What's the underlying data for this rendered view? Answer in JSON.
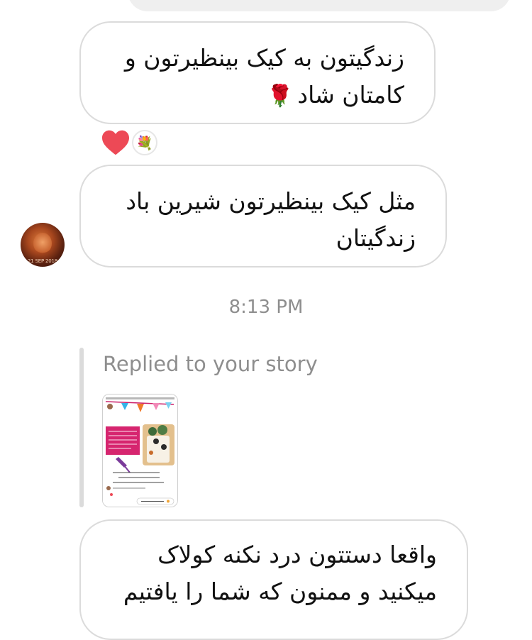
{
  "conversation": {
    "messages": [
      {
        "lines": [
          "زندگیتون به کیک بینظیرتون و",
          "کامتان شاد"
        ],
        "trailing_emoji": "rose-emoji",
        "reactions": [
          "heart-reaction",
          "bouquet-reaction"
        ]
      },
      {
        "lines": [
          "مثل کیک بینظیرتون شیرین باد",
          "زندگیتان"
        ]
      },
      {
        "lines": [
          "واقعا دستتون درد نکنه کولاک",
          "میکنید و ممنون که شما را یافتیم"
        ]
      }
    ],
    "timestamp": "8:13 PM",
    "story_reply_label": "Replied to your story",
    "avatar_overlay_text": "21 SEP 2018"
  },
  "colors": {
    "bubble_border": "#dbdbdb",
    "secondary_text": "#8e8e8e",
    "heart_red": "#ed4956",
    "top_bubble_bg": "#efefef"
  }
}
